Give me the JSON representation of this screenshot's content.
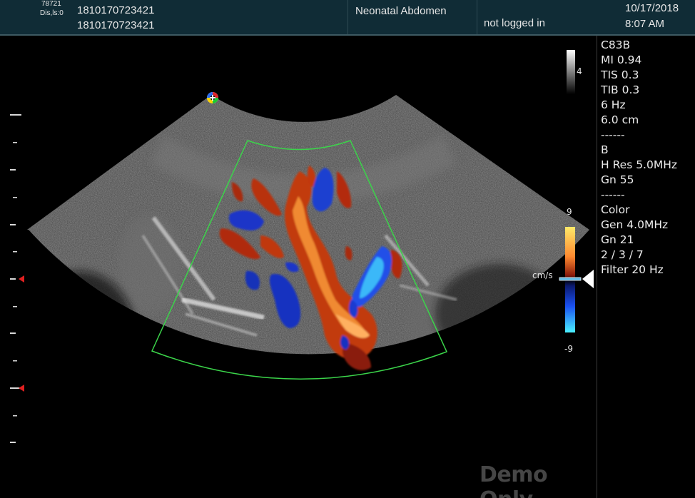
{
  "header": {
    "id_small": "78721",
    "dis_small": "Dis,ls:0",
    "patient_id_1": "1810170723421",
    "patient_id_2": "1810170723421",
    "exam": "Neonatal Abdomen",
    "login_status": "not logged in",
    "date": "10/17/2018",
    "time": "8:07 AM"
  },
  "params": [
    "C83B",
    "MI 0.94",
    "TIS 0.3",
    "TIB 0.3",
    "6 Hz",
    "6.0 cm",
    "------",
    "B",
    "H Res  5.0MHz",
    "Gn 55",
    "------",
    "Color",
    "Gen  4.0MHz",
    "Gn 21",
    "2 / 3 / 7",
    "Filter 20 Hz"
  ],
  "gray_scale": {
    "label": "4"
  },
  "color_scale": {
    "top": "9",
    "bottom": "-9",
    "unit": "cm/s"
  },
  "watermark": "Demo Only",
  "icons": {
    "orientation": "orientation-marker-icon",
    "focus": "focus-marker-icon",
    "baseline": "baseline-pointer-icon"
  },
  "colors": {
    "header_bg": "#102c36",
    "flow_red": "#c23a10",
    "flow_orange": "#f08a30",
    "flow_blue": "#1a3ad0",
    "flow_cyan": "#3ad8ff",
    "roi_outline": "#3bd44a"
  }
}
